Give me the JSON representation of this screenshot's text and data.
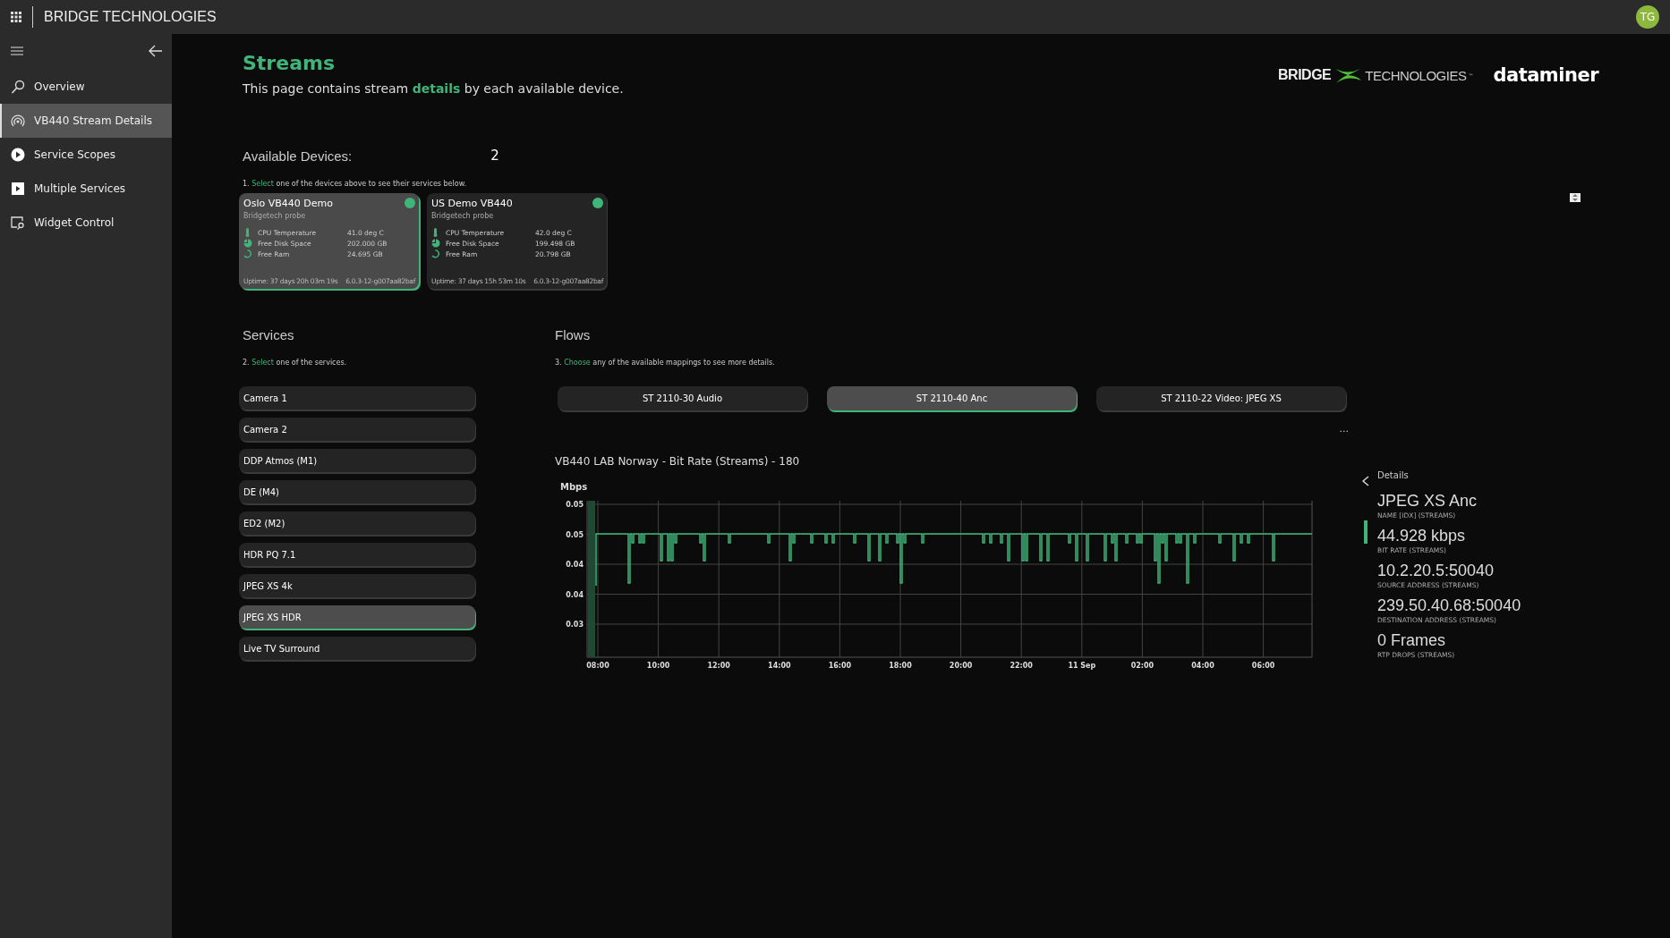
{
  "app_bar": {
    "title": "BRIDGE TECHNOLOGIES",
    "avatar": "TG"
  },
  "sidebar": {
    "items": [
      {
        "label": "Overview",
        "kind": "search",
        "selected": false
      },
      {
        "label": "VB440 Stream Details",
        "kind": "broadcast",
        "selected": true
      },
      {
        "label": "Service Scopes",
        "kind": "play-circle",
        "selected": false
      },
      {
        "label": "Multiple Services",
        "kind": "play-square",
        "selected": false
      },
      {
        "label": "Widget Control",
        "kind": "widget",
        "selected": false
      }
    ]
  },
  "header": {
    "title": "Streams",
    "subtitle": "This page contains stream **details** by each available device.",
    "logo_left": "BRIDGE",
    "logo_right": "TECHNOLOGIES",
    "logo_tm": "™",
    "logo_second": "dataminer"
  },
  "devices": {
    "heading": "Available Devices:",
    "count": "2",
    "hint": "1. **Select** one of the devices above to see their services below.",
    "items": [
      {
        "name": "Oslo VB440 Demo",
        "type": "Bridgetech probe",
        "color": "#3fb57a",
        "selected": true,
        "metrics": [
          {
            "kind": "thermometer",
            "label": "CPU Temperature",
            "value": "41.0 deg C"
          },
          {
            "kind": "pie",
            "label": "Free Disk Space",
            "value": "202.000 GB"
          },
          {
            "kind": "ring",
            "label": "Free Ram",
            "value": "24.695 GB"
          }
        ],
        "uptime": "Uptime: 37 days 20h 03m 19s",
        "version": "6.0.3-12-g007aa82baf"
      },
      {
        "name": "US Demo VB440",
        "type": "Bridgetech probe",
        "color": "#3fb57a",
        "selected": false,
        "metrics": [
          {
            "kind": "thermometer",
            "label": "CPU Temperature",
            "value": "42.0 deg C"
          },
          {
            "kind": "pie",
            "label": "Free Disk Space",
            "value": "199.498 GB"
          },
          {
            "kind": "ring",
            "label": "Free Ram",
            "value": "20.798 GB"
          }
        ],
        "uptime": "Uptime: 37 days 15h 53m 10s",
        "version": "6.0.3-12-g007aa82baf"
      }
    ]
  },
  "services": {
    "heading": "Services",
    "hint": "2. **Select** one of the services.",
    "items": [
      {
        "label": "Camera 1",
        "selected": false
      },
      {
        "label": "Camera 2",
        "selected": false
      },
      {
        "label": "DDP Atmos (M1)",
        "selected": false
      },
      {
        "label": "DE (M4)",
        "selected": false
      },
      {
        "label": "ED2 (M2)",
        "selected": false
      },
      {
        "label": "HDR PQ 7.1",
        "selected": false
      },
      {
        "label": "JPEG XS 4k",
        "selected": false
      },
      {
        "label": "JPEG XS HDR",
        "selected": true
      },
      {
        "label": "Live TV Surround",
        "selected": false
      }
    ]
  },
  "flows": {
    "heading": "Flows",
    "hint": "3. **Choose** any of the available mappings to see more details.",
    "items": [
      {
        "label": "ST 2110-30 Audio",
        "selected": false
      },
      {
        "label": "ST 2110-40 Anc",
        "selected": true
      },
      {
        "label": "ST 2110-22 Video: JPEG XS",
        "selected": false
      }
    ],
    "more": "..."
  },
  "chart": {
    "title": "VB440 LAB Norway - Bit Rate (Streams) - 180",
    "unit": "Mbps",
    "y_labels": [
      "0.05",
      "0.05",
      "0.04",
      "0.04",
      "0.03"
    ],
    "x_labels": [
      "08:00",
      "10:00",
      "12:00",
      "14:00",
      "16:00",
      "18:00",
      "20:00",
      "22:00",
      "11 Sep",
      "02:00",
      "04:00",
      "06:00"
    ]
  },
  "details": {
    "heading": "Details",
    "items": [
      {
        "value": "JPEG XS Anc",
        "label": "NAME [IDX] (STREAMS)"
      },
      {
        "value": "44.928 kbps",
        "label": "BIT RATE (STREAMS)"
      },
      {
        "value": "10.2.20.5:50040",
        "label": "SOURCE ADDRESS (STREAMS)"
      },
      {
        "value": "239.50.40.68:50040",
        "label": "DESTINATION ADDRESS (STREAMS)"
      },
      {
        "value": "0 Frames",
        "label": "RTP DROPS (STREAMS)"
      }
    ]
  }
}
